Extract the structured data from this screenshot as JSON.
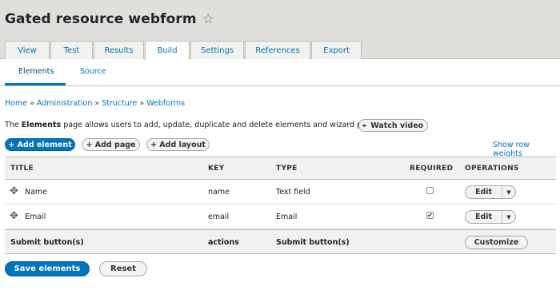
{
  "header": {
    "title": "Gated resource webform",
    "tabs": [
      {
        "label": "View"
      },
      {
        "label": "Test"
      },
      {
        "label": "Results"
      },
      {
        "label": "Build",
        "active": true
      },
      {
        "label": "Settings"
      },
      {
        "label": "References"
      },
      {
        "label": "Export"
      }
    ]
  },
  "subtabs": [
    {
      "label": "Elements",
      "active": true
    },
    {
      "label": "Source"
    }
  ],
  "breadcrumb": [
    "Home",
    "Administration",
    "Structure",
    "Webforms"
  ],
  "intro": {
    "prefix": "The ",
    "bold": "Elements",
    "suffix": " page allows users to add, update, duplicate and delete elements and wizard pages.",
    "watch_video": "Watch video"
  },
  "actions": {
    "add_element": "+ Add element",
    "add_page": "+ Add page",
    "add_layout": "+ Add layout",
    "show_row_weights": "Show row weights"
  },
  "table": {
    "headers": [
      "TITLE",
      "KEY",
      "TYPE",
      "REQUIRED",
      "OPERATIONS"
    ],
    "rows": [
      {
        "title": "Name",
        "key": "name",
        "type": "Text field",
        "required": false,
        "operation": "Edit"
      },
      {
        "title": "Email",
        "key": "email",
        "type": "Email",
        "required": true,
        "operation": "Edit"
      }
    ],
    "submit_row": {
      "title": "Submit button(s)",
      "key": "actions",
      "type": "Submit button(s)",
      "operation": "Customize"
    }
  },
  "footer": {
    "save": "Save elements",
    "reset": "Reset"
  },
  "colors": {
    "accent": "#0074bd",
    "header_bg": "#e0dfdc"
  }
}
